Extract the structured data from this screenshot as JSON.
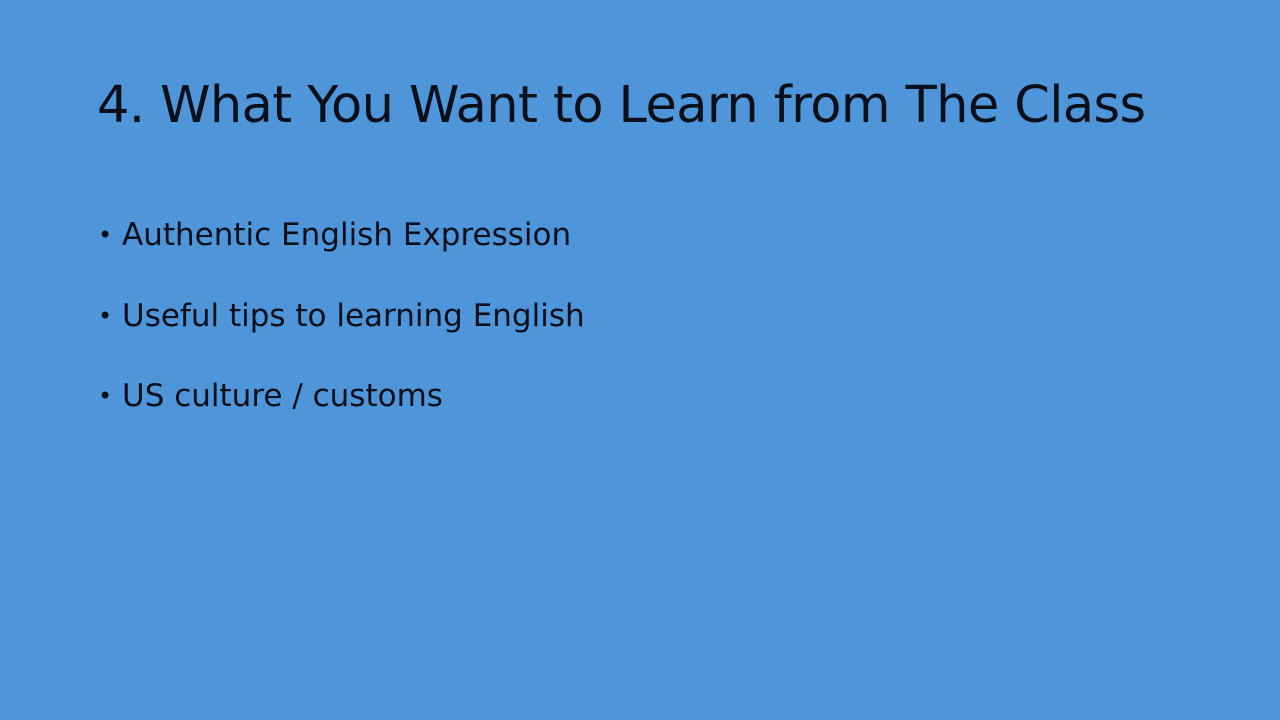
{
  "slide": {
    "title": "4. What You Want to Learn from The Class",
    "bullet_symbol": "•",
    "bullets": [
      "Authentic English Expression",
      "Useful tips to learning English",
      "US culture / customs"
    ]
  },
  "colors": {
    "background": "#4f95da",
    "text": "#0a0f1a"
  }
}
